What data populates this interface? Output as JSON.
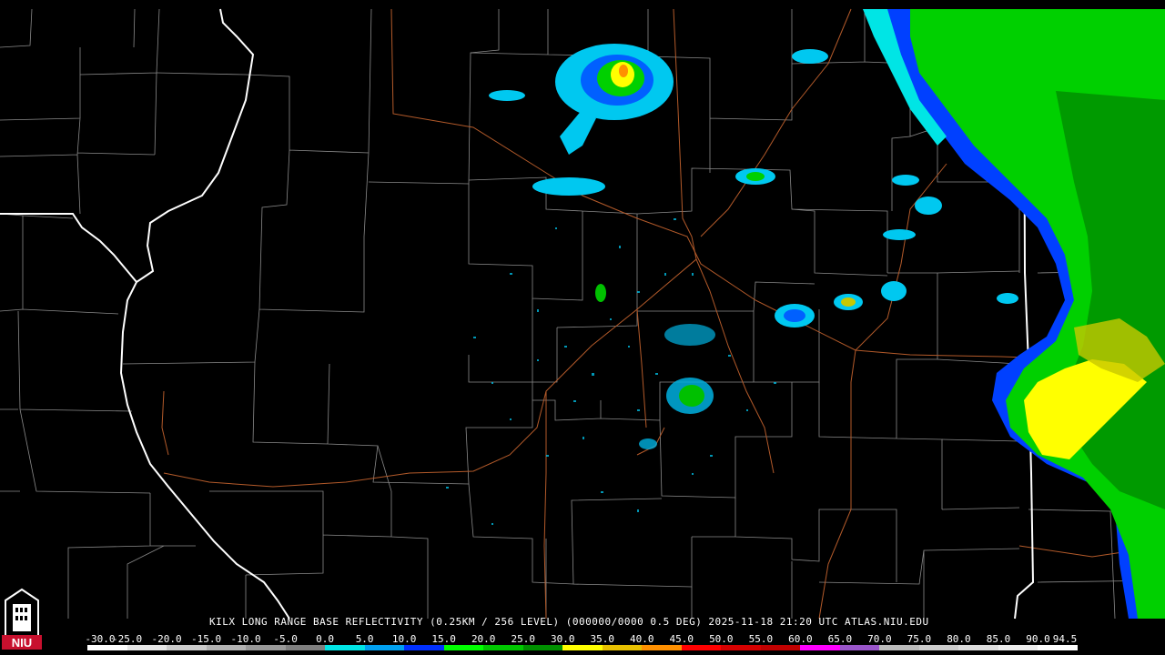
{
  "product": {
    "title": "KILX LONG RANGE BASE REFLECTIVITY (0.25KM / 256 LEVEL) (000000/0000 0.5 DEG) 2025-11-18 21:20 UTC  ATLAS.NIU.EDU"
  },
  "logo": {
    "text": "NIU",
    "colors": {
      "primary": "#c8102e",
      "outline": "#ffffff"
    }
  },
  "legend": {
    "labels": [
      "-30.0",
      "-25.0",
      "-20.0",
      "-15.0",
      "-10.0",
      "-5.0",
      "0.0",
      "5.0",
      "10.0",
      "15.0",
      "20.0",
      "25.0",
      "30.0",
      "35.0",
      "40.0",
      "45.0",
      "50.0",
      "55.0",
      "60.0",
      "65.0",
      "70.0",
      "75.0",
      "80.0",
      "85.0",
      "90.0",
      "94.5"
    ],
    "colors": [
      "#ffffff",
      "#e6e6e6",
      "#cccccc",
      "#b3b3b3",
      "#999999",
      "#7f7f7f",
      "#00e5e5",
      "#00a0f0",
      "#0030ff",
      "#00ff00",
      "#00c800",
      "#009000",
      "#ffff00",
      "#e7c000",
      "#ff9000",
      "#ff0000",
      "#d60000",
      "#c00000",
      "#ff00ff",
      "#9955c9",
      "#bbbbbb",
      "#cccccc",
      "#dddddd",
      "#eeeeee",
      "#ffffff"
    ]
  },
  "colors": {
    "background": "#000000",
    "county_lines": "#8a8a8a",
    "state_lines": "#ffffff",
    "highways": "#b35a2a"
  }
}
